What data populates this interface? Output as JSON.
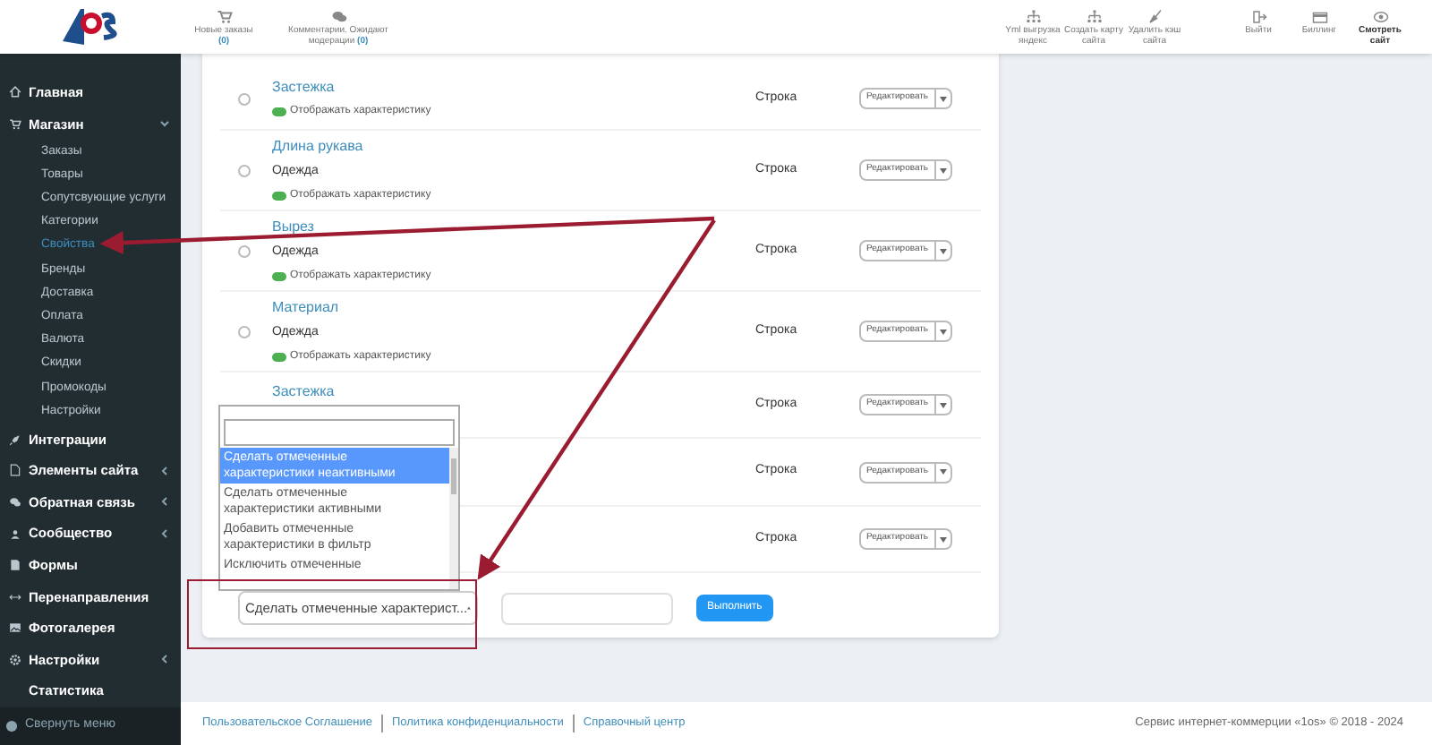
{
  "header": {
    "left_links": [
      {
        "kind": "cart",
        "label": "Новые заказы",
        "count": "(0)"
      },
      {
        "kind": "comments",
        "label": "Комментарии. Ожидают модерации",
        "count": "(0)"
      }
    ],
    "right_links": [
      {
        "kind": "sitemap",
        "label": "Yml выгрузка яндекс"
      },
      {
        "kind": "sitemap",
        "label": "Создать карту сайта"
      },
      {
        "kind": "broom",
        "label": "Удалить кэш сайта"
      },
      {
        "kind": "logout",
        "label": "Выйти"
      },
      {
        "kind": "card",
        "label": "Биллинг"
      },
      {
        "kind": "eye",
        "label": "Смотреть сайт"
      }
    ]
  },
  "sidebar": {
    "items": [
      {
        "label": "Главная"
      },
      {
        "label": "Магазин",
        "expanded": true,
        "children": [
          {
            "label": "Заказы",
            "selected": false
          },
          {
            "label": "Товары",
            "selected": false
          },
          {
            "label": "Сопутсвующие услуги",
            "selected": false
          },
          {
            "label": "Категории",
            "selected": false
          },
          {
            "label": "Свойства",
            "selected": true
          },
          {
            "label": "Бренды",
            "selected": false
          },
          {
            "label": "Доставка",
            "selected": false
          },
          {
            "label": "Оплата",
            "selected": false
          },
          {
            "label": "Валюта",
            "selected": false
          },
          {
            "label": "Скидки",
            "selected": false
          },
          {
            "label": "Промокоды",
            "selected": false
          },
          {
            "label": "Настройки",
            "selected": false
          }
        ]
      },
      {
        "label": "Интеграции"
      },
      {
        "label": "Элементы сайта",
        "expanded": false
      },
      {
        "label": "Обратная связь",
        "expanded": false
      },
      {
        "label": "Сообщество",
        "expanded": false
      },
      {
        "label": "Формы"
      },
      {
        "label": "Перенаправления"
      },
      {
        "label": "Фотогалерея"
      },
      {
        "label": "Настройки",
        "expanded": false
      },
      {
        "label": "Статистика"
      }
    ],
    "collapse": "Свернуть меню"
  },
  "rows": [
    {
      "checked": false,
      "name": "Застежка",
      "display": "Отображать характеристику",
      "display_on": true,
      "type": "Строка",
      "edit": "Редактировать"
    },
    {
      "checked": false,
      "name": "Длина рукава",
      "category": "Одежда",
      "display": "Отображать характеристику",
      "display_on": true,
      "type": "Строка",
      "edit": "Редактировать"
    },
    {
      "checked": false,
      "name": "Вырез",
      "category": "Одежда",
      "display": "Отображать характеристику",
      "display_on": true,
      "type": "Строка",
      "edit": "Редактировать"
    },
    {
      "checked": false,
      "name": "Материал",
      "category": "Одежда",
      "display": "Отображать характеристику",
      "display_on": true,
      "type": "Строка",
      "edit": "Редактировать"
    },
    {
      "name": "Застежка",
      "type": "Строка",
      "edit": "Редактировать"
    },
    {
      "type": "Строка",
      "edit": "Редактировать"
    },
    {
      "type": "Строка",
      "edit": "Редактировать"
    }
  ],
  "bulk": {
    "select_value": "Сделать отмеченные характерист...",
    "options": [
      {
        "label": "Сделать отмеченные характеристики неактивными",
        "selected": true
      },
      {
        "label": "Сделать отмеченные характеристики активными",
        "selected": false
      },
      {
        "label": "Добавить отмеченные характеристики в фильтр",
        "selected": false
      },
      {
        "label": "Исключить отмеченные",
        "selected": false
      }
    ],
    "run": "Выполнить"
  },
  "footer": {
    "links": [
      "Пользовательское Соглашение",
      "Политика конфиденциальности",
      "Справочный центр"
    ],
    "copyright": "Сервис интернет-коммерции «1os» © 2018 - 2024"
  }
}
